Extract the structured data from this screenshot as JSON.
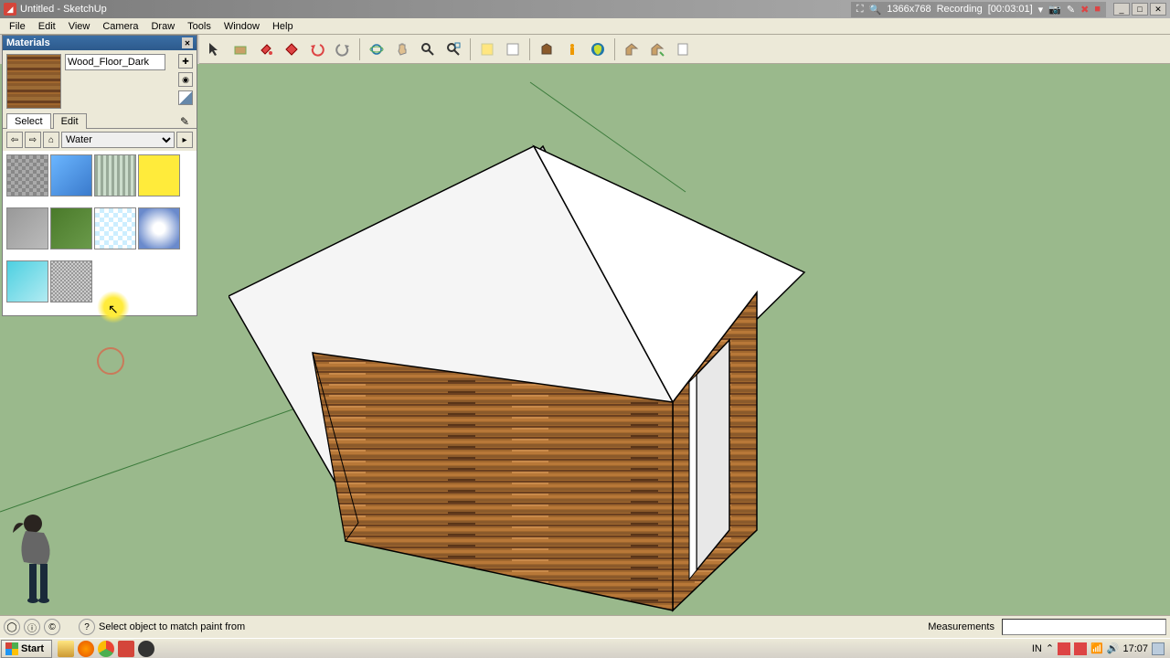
{
  "title": "Untitled - SketchUp",
  "recording": {
    "res": "1366x768",
    "label": "Recording",
    "time": "[00:03:01]"
  },
  "menu": [
    "File",
    "Edit",
    "View",
    "Camera",
    "Draw",
    "Tools",
    "Window",
    "Help"
  ],
  "materials": {
    "panel_title": "Materials",
    "current_name": "Wood_Floor_Dark",
    "tabs": {
      "select": "Select",
      "edit": "Edit"
    },
    "category": "Water"
  },
  "status": {
    "hint": "Select object to match paint from",
    "measurements_label": "Measurements"
  },
  "taskbar": {
    "start": "Start",
    "lang": "IN",
    "time": "17:07"
  }
}
